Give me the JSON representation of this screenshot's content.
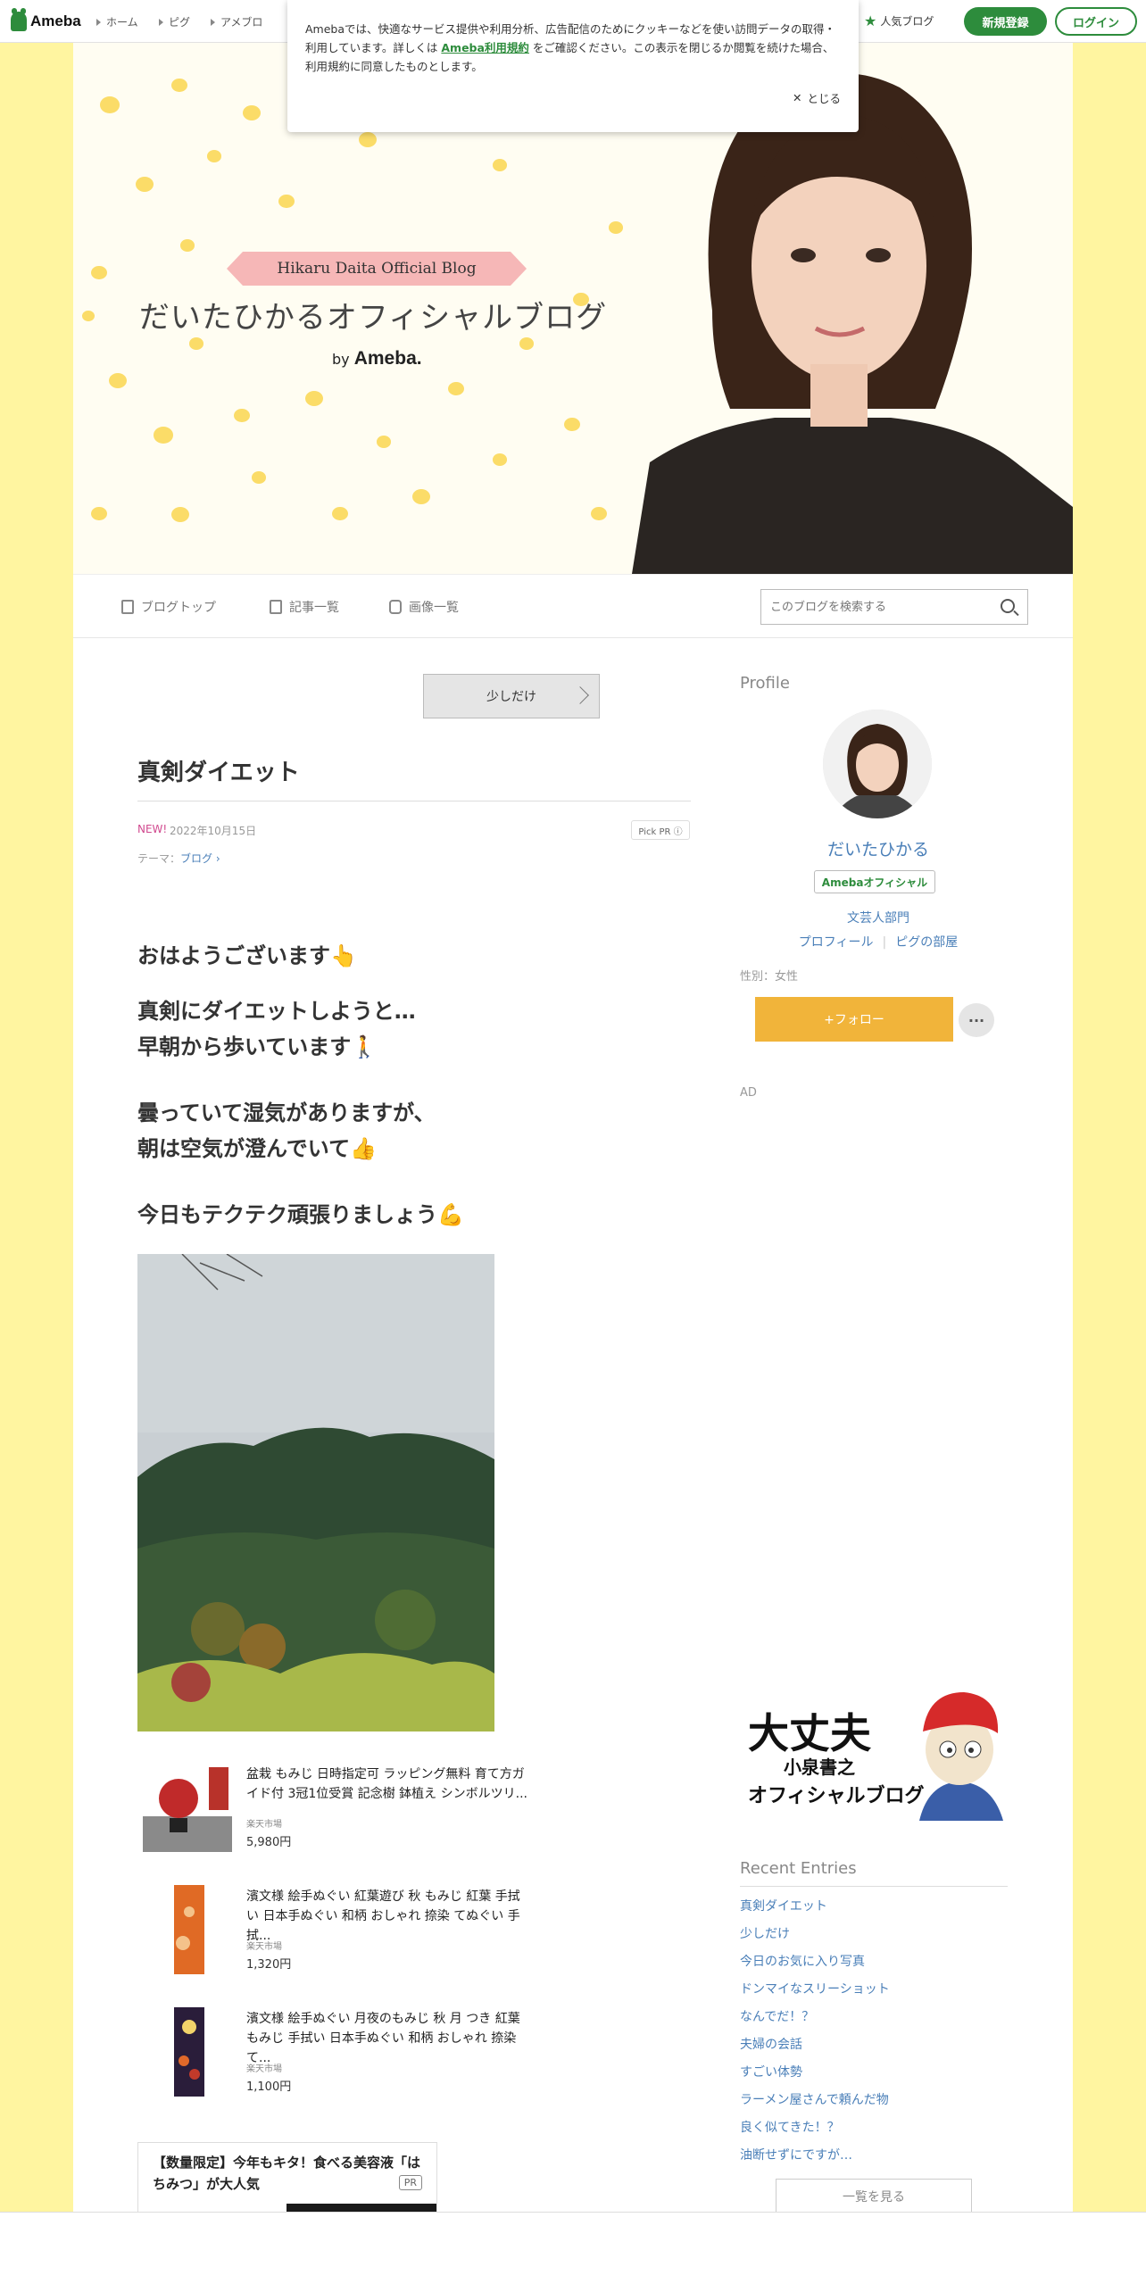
{
  "topbar": {
    "logo": "Ameba",
    "nav": [
      "ホーム",
      "ピグ",
      "アメブロ"
    ],
    "popular": "人気ブログ",
    "signup": "新規登録",
    "login": "ログイン"
  },
  "cookie": {
    "text_before": "Amebaでは、快適なサービス提供や利用分析、広告配信のためにクッキーなどを使い訪問データの取得・利用しています。詳しくは",
    "link": "Ameba利用規約",
    "text_after": "をご確認ください。この表示を閉じるか閲覧を続けた場合、利用規約に同意したものとします。",
    "close": "とじる"
  },
  "banner": {
    "ribbon": "Hikaru Daita Official Blog",
    "title": "だいたひかるオフィシャルブログ",
    "by": "by",
    "ameba": "Ameba."
  },
  "navbar": {
    "items": [
      "ブログトップ",
      "記事一覧",
      "画像一覧"
    ],
    "search_placeholder": "このブログを検索する"
  },
  "entry": {
    "prev_button": "少しだけ",
    "title": "真剣ダイエット",
    "new": "NEW!",
    "date": "2022年10月15日",
    "pickpr": "Pick PR ⓘ",
    "theme_label": "テーマ：",
    "theme": "ブログ",
    "body": [
      "おはようございます👆",
      "真剣にダイエットしようと…",
      "早朝から歩いています🚶",
      "曇っていて湿気がありますが、",
      "朝は空気が澄んでいて👍",
      "今日もテクテク頑張りましょう💪"
    ]
  },
  "products": [
    {
      "name": "盆栽 もみじ 日時指定可 ラッピング無料 育て方ガイド付 3冠1位受賞 記念樹 鉢植え シンボルツリ...",
      "shop": "楽天市場",
      "price": "5,980円"
    },
    {
      "name": "濱文様 絵手ぬぐい 紅葉遊び 秋 もみじ 紅葉 手拭い 日本手ぬぐい 和柄 おしゃれ 捺染 てぬぐい 手拭...",
      "shop": "楽天市場",
      "price": "1,320円"
    },
    {
      "name": "濱文様 絵手ぬぐい 月夜のもみじ 秋 月 つき 紅葉 もみじ 手拭い 日本手ぬぐい 和柄 おしゃれ 捺染 て...",
      "shop": "楽天市場",
      "price": "1,100円"
    }
  ],
  "ad": {
    "title": "【数量限定】今年もキタ！食べる美容液「はちみつ」が大人気",
    "pr": "PR"
  },
  "sidebar": {
    "profile_heading": "Profile",
    "name": "だいたひかる",
    "badge": "Amebaオフィシャル",
    "category": "文芸人部門",
    "link_profile": "プロフィール",
    "link_pig": "ピグの部屋",
    "gender": "性別：女性",
    "follow": "+フォロー",
    "more": "···",
    "ad_label": "AD",
    "banner_line1": "大丈夫",
    "banner_line2": "小泉書之",
    "banner_line3": "オフィシャルブログ",
    "recent_heading": "Recent Entries",
    "recent": [
      "真剣ダイエット",
      "少しだけ",
      "今日のお気に入り写真",
      "ドンマイなスリーショット",
      "なんでだ！？",
      "夫婦の会話",
      "すごい体勢",
      "ラーメン屋さんで頼んだ物",
      "良く似てきた！？",
      "油断せずにですが…"
    ],
    "list_button": "一覧を見る"
  },
  "colors": {
    "accent_green": "#2d8c3c",
    "link_blue": "#4a7fb8",
    "follow_orange": "#f1b43a",
    "page_yellow": "#fff5a0"
  }
}
